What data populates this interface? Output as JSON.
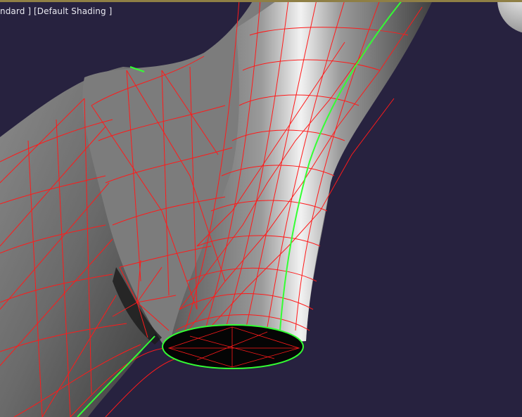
{
  "viewport": {
    "label": "ndard ] [Default Shading ]",
    "colors": {
      "background": "#27223f",
      "wireframe": "#ff1a1a",
      "seam": "#33ff33",
      "border": "#8f7f45",
      "label": "#e8e8f0"
    },
    "gizmo_icon": "view-cube-sphere-icon"
  }
}
